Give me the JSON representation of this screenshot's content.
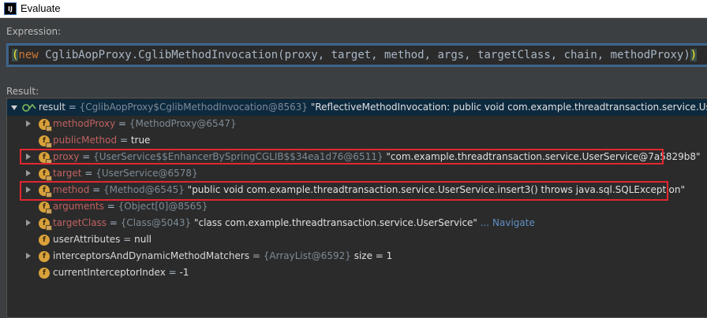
{
  "window": {
    "title": "Evaluate",
    "app_icon": "IJ"
  },
  "expression": {
    "label": "Expression:",
    "open_paren": "(",
    "keyword": "new",
    "body": " CglibAopProxy.CglibMethodInvocation(proxy, target, method, args, targetClass, chain, methodProxy)",
    "close_paren": ")"
  },
  "result": {
    "label": "Result:",
    "root": {
      "name": "result",
      "eq": " = ",
      "ref": "{CglibAopProxy$CglibMethodInvocation@8563}",
      "value": " \"ReflectiveMethodInvocation: public void com.example.threadtransaction.service.UserServ"
    },
    "children": [
      {
        "name": "methodProxy",
        "eq": " = ",
        "ref": "{MethodProxy@6547}",
        "value": "",
        "expandable": true,
        "color": "red"
      },
      {
        "name": "publicMethod",
        "eq": " = ",
        "ref": "",
        "value": "true",
        "expandable": false,
        "color": "red"
      },
      {
        "name": "proxy",
        "eq": " = ",
        "ref": "{UserService$$EnhancerBySpringCGLIB$$34ea1d76@6511}",
        "value": " \"com.example.threadtransaction.service.UserService@7a5829b8\"",
        "expandable": true,
        "color": "red"
      },
      {
        "name": "target",
        "eq": " = ",
        "ref": "{UserService@6578}",
        "value": "",
        "expandable": true,
        "color": "red"
      },
      {
        "name": "method",
        "eq": " = ",
        "ref": "{Method@6545}",
        "value": " \"public void com.example.threadtransaction.service.UserService.insert3() throws java.sql.SQLException\"",
        "expandable": true,
        "color": "red"
      },
      {
        "name": "arguments",
        "eq": " = ",
        "ref": "{Object[0]@8565}",
        "value": "",
        "expandable": false,
        "color": "red"
      },
      {
        "name": "targetClass",
        "eq": " = ",
        "ref": "{Class@5043}",
        "value": " \"class com.example.threadtransaction.service.UserService\"",
        "link": "... Navigate",
        "expandable": true,
        "color": "red"
      },
      {
        "name": "userAttributes",
        "eq": " = ",
        "ref": "",
        "value": "null",
        "expandable": false,
        "color": "white"
      },
      {
        "name": "interceptorsAndDynamicMethodMatchers",
        "eq": " = ",
        "ref": "{ArrayList@6592}",
        "value": "  size = 1",
        "expandable": true,
        "color": "white"
      },
      {
        "name": "currentInterceptorIndex",
        "eq": " = ",
        "ref": "",
        "value": "-1",
        "expandable": false,
        "color": "white"
      }
    ]
  },
  "colors": {
    "background": "#3c3f41",
    "tree_background": "#2b2b2b",
    "selection": "#0d293e",
    "highlight_box": "#e3262f",
    "field_name": "#c16161",
    "reference": "#7d8b96"
  },
  "icons": {
    "app": "intellij-icon",
    "field": "field-icon",
    "watch": "watch-result-icon",
    "expand": "expand-arrow-icon",
    "collapse": "collapse-arrow-icon"
  }
}
